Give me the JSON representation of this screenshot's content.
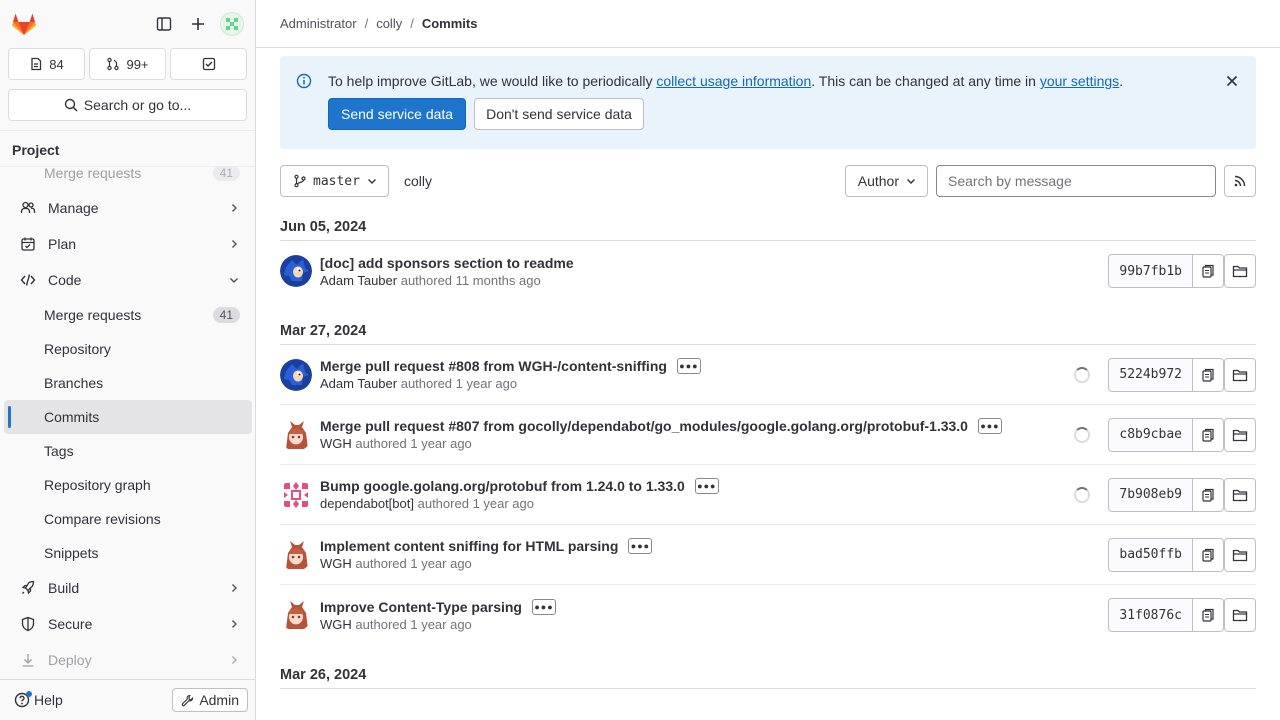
{
  "sidebar": {
    "counts": {
      "issues": "84",
      "merge_requests": "99+"
    },
    "search_label": "Search or go to...",
    "section_title": "Project",
    "items": [
      {
        "label": "Merge requests",
        "badge": "41"
      },
      {
        "label": "Manage"
      },
      {
        "label": "Plan"
      },
      {
        "label": "Code"
      },
      {
        "label": "Merge requests",
        "badge": "41"
      },
      {
        "label": "Repository"
      },
      {
        "label": "Branches"
      },
      {
        "label": "Commits"
      },
      {
        "label": "Tags"
      },
      {
        "label": "Repository graph"
      },
      {
        "label": "Compare revisions"
      },
      {
        "label": "Snippets"
      },
      {
        "label": "Build"
      },
      {
        "label": "Secure"
      },
      {
        "label": "Deploy"
      }
    ],
    "help_label": "Help",
    "admin_label": "Admin"
  },
  "breadcrumb": {
    "root": "Administrator",
    "project": "colly",
    "current": "Commits"
  },
  "alert": {
    "text_before": "To help improve GitLab, we would like to periodically ",
    "link1": "collect usage information",
    "text_middle": ". This can be changed at any time in ",
    "link2": "your settings",
    "text_after": ".",
    "primary_button": "Send service data",
    "secondary_button": "Don't send service data"
  },
  "filters": {
    "branch": "master",
    "project": "colly",
    "author_label": "Author",
    "search_placeholder": "Search by message"
  },
  "days": [
    {
      "date": "Jun 05, 2024",
      "commits": [
        {
          "title": "[doc] add sponsors section to readme",
          "author": "Adam Tauber",
          "verb": "authored",
          "time": "11 months ago",
          "sha": "99b7fb1b",
          "ellipsis": false,
          "pending": false,
          "avatar": "sonic"
        }
      ]
    },
    {
      "date": "Mar 27, 2024",
      "commits": [
        {
          "title": "Merge pull request #808 from WGH-/content-sniffing",
          "author": "Adam Tauber",
          "verb": "authored",
          "time": "1 year ago",
          "sha": "5224b972",
          "ellipsis": true,
          "pending": true,
          "avatar": "sonic"
        },
        {
          "title": "Merge pull request #807 from gocolly/dependabot/go_modules/google.golang.org/protobuf-1.33.0",
          "author": "WGH",
          "verb": "authored",
          "time": "1 year ago",
          "sha": "c8b9cbae",
          "ellipsis": true,
          "pending": true,
          "avatar": "anime"
        },
        {
          "title": "Bump google.golang.org/protobuf from 1.24.0 to 1.33.0",
          "author": "dependabot[bot]",
          "verb": "authored",
          "time": "1 year ago",
          "sha": "7b908eb9",
          "ellipsis": true,
          "pending": true,
          "avatar": "identicon"
        },
        {
          "title": "Implement content sniffing for HTML parsing",
          "author": "WGH",
          "verb": "authored",
          "time": "1 year ago",
          "sha": "bad50ffb",
          "ellipsis": true,
          "pending": false,
          "avatar": "anime"
        },
        {
          "title": "Improve Content-Type parsing",
          "author": "WGH",
          "verb": "authored",
          "time": "1 year ago",
          "sha": "31f0876c",
          "ellipsis": true,
          "pending": false,
          "avatar": "anime"
        }
      ]
    },
    {
      "date": "Mar 26, 2024",
      "commits": []
    }
  ]
}
